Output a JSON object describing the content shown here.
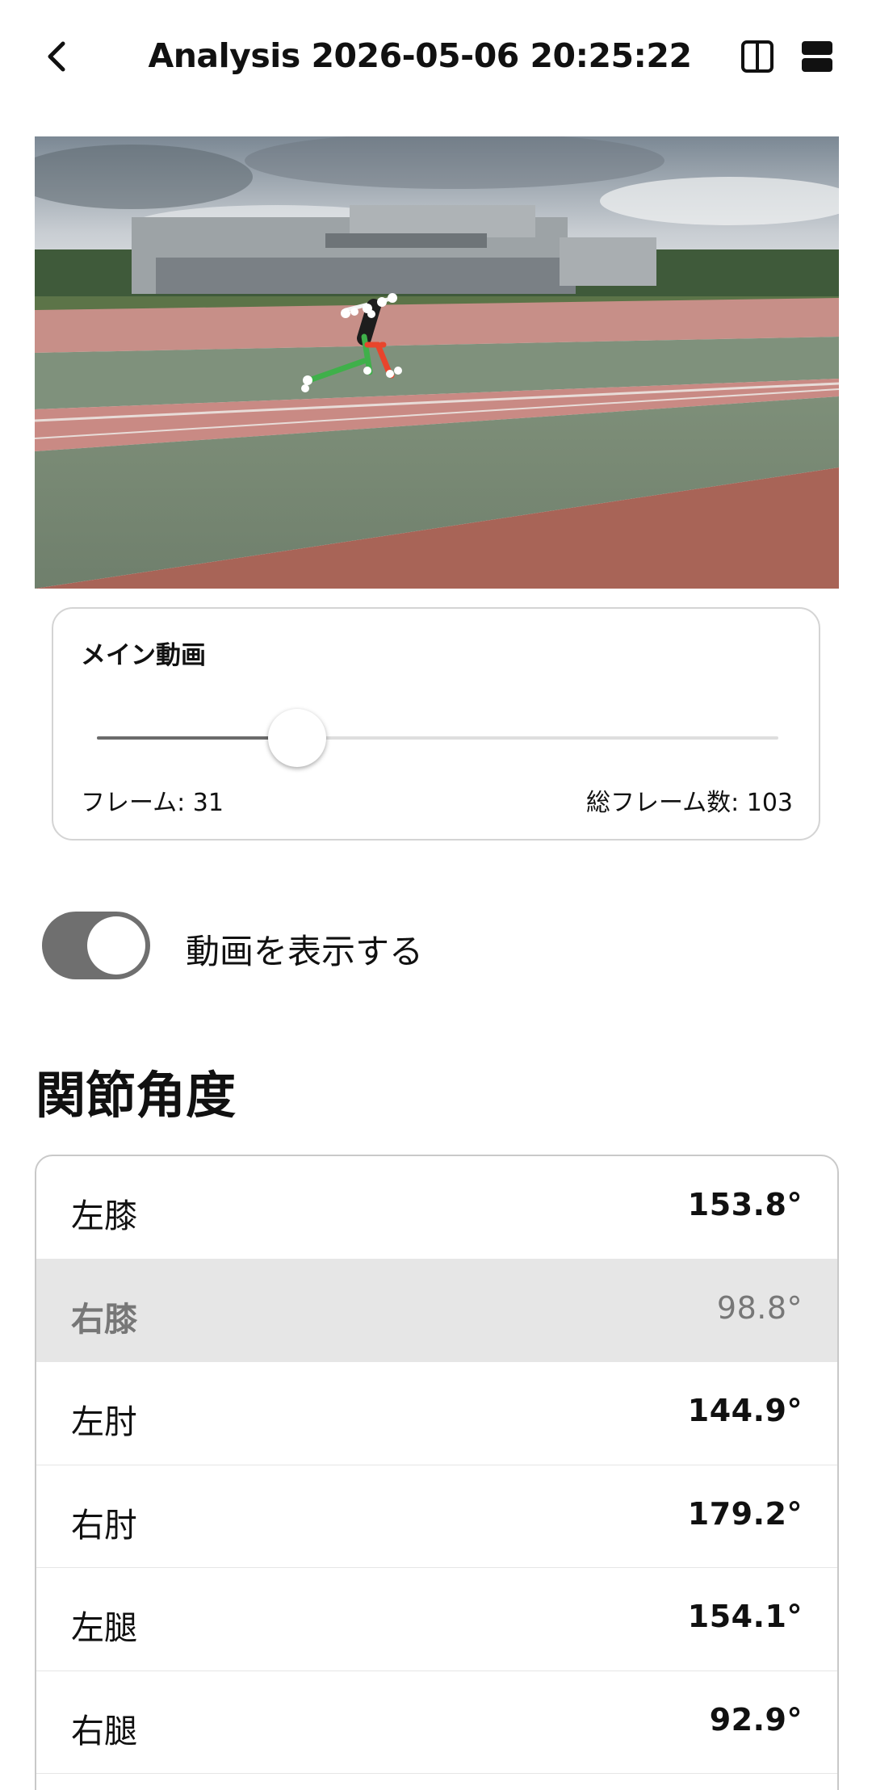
{
  "header": {
    "title": "Analysis 2026-05-06 20:25:22",
    "back_icon": "chevron-left-icon",
    "split_icon": "split-view-icon",
    "stack_icon": "stacked-view-icon"
  },
  "player": {
    "label": "メイン動画",
    "frame_text": "フレーム: 31",
    "total_text": "総フレーム数: 103",
    "current_frame": 31,
    "total_frames": 103
  },
  "toggle": {
    "label": "動画を表示する",
    "on": true
  },
  "angles": {
    "title": "関節角度",
    "rows": [
      {
        "name": "左膝",
        "value": "153.8°",
        "selected": false
      },
      {
        "name": "右膝",
        "value": "98.8°",
        "selected": true
      },
      {
        "name": "左肘",
        "value": "144.9°",
        "selected": false
      },
      {
        "name": "右肘",
        "value": "179.2°",
        "selected": false
      },
      {
        "name": "左腿",
        "value": "154.1°",
        "selected": false
      },
      {
        "name": "右腿",
        "value": "92.9°",
        "selected": false
      },
      {
        "name": "",
        "value": "",
        "selected": false
      }
    ]
  },
  "colors": {
    "accent_gray": "#6f6f6f",
    "selected_row": "#e6e6e6",
    "skeleton_left": "#3fb04a",
    "skeleton_right": "#e8452c"
  }
}
